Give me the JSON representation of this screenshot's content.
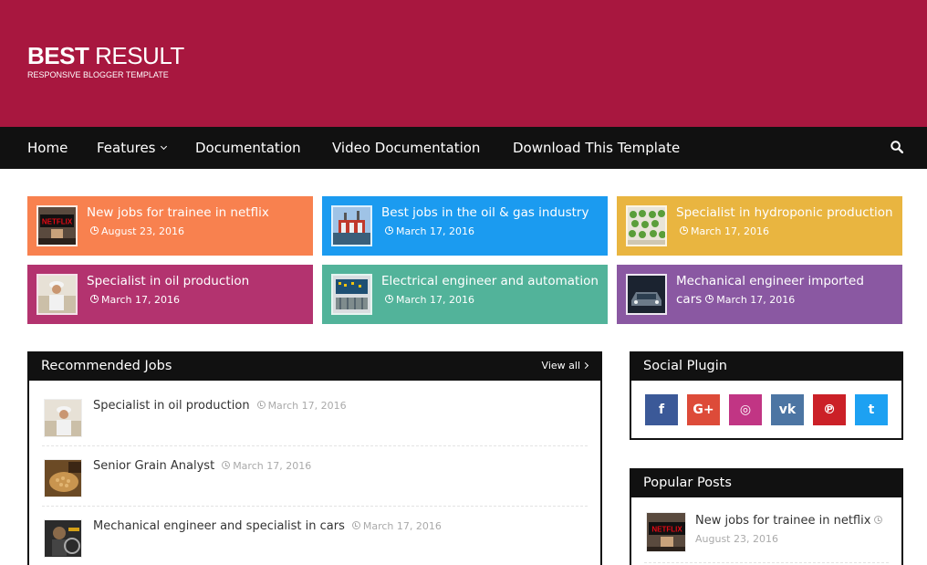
{
  "header": {
    "logo_bold": "BEST",
    "logo_regular": "RESULT",
    "logo_subtitle": "RESPONSIVE BLOGGER TEMPLATE",
    "bg_color": "#a8173f"
  },
  "nav": {
    "items": [
      {
        "label": "Home"
      },
      {
        "label": "Features",
        "dropdown": true
      },
      {
        "label": "Documentation"
      },
      {
        "label": "Video Documentation"
      },
      {
        "label": "Download This Template"
      }
    ],
    "search_icon": "search-icon"
  },
  "featured": [
    {
      "title": "New jobs for trainee in netflix",
      "date": "August 23, 2016",
      "color": "#f8814f",
      "thumb": "netflix"
    },
    {
      "title": "Best jobs in the oil & gas industry",
      "date": "March 17, 2016",
      "color": "#1b9bf0",
      "thumb": "oil-rig"
    },
    {
      "title": "Specialist in hydroponic production",
      "date": "March 17, 2016",
      "color": "#e9b540",
      "thumb": "hydroponic"
    },
    {
      "title": "Specialist in oil production",
      "date": "March 17, 2016",
      "color": "#b3336f",
      "thumb": "worker"
    },
    {
      "title": "Electrical engineer and automation",
      "date": "March 17, 2016",
      "color": "#52b39a",
      "thumb": "electrical"
    },
    {
      "title": "Mechanical engineer imported cars",
      "date": "March 17, 2016",
      "color": "#8a58a2",
      "thumb": "car"
    }
  ],
  "recommended": {
    "title": "Recommended Jobs",
    "view_all": "View all",
    "items": [
      {
        "title": "Specialist in oil production",
        "date": "March 17, 2016",
        "thumb": "worker"
      },
      {
        "title": "Senior Grain Analyst",
        "date": "March 17, 2016",
        "thumb": "grain"
      },
      {
        "title": "Mechanical engineer and specialist in cars",
        "date": "March 17, 2016",
        "thumb": "mechanic"
      }
    ]
  },
  "social": {
    "title": "Social Plugin",
    "buttons": [
      {
        "name": "facebook",
        "glyph": "f",
        "color": "#3b5998"
      },
      {
        "name": "google-plus",
        "glyph": "G+",
        "color": "#dd4b39"
      },
      {
        "name": "instagram",
        "glyph": "◎",
        "color": "#c13584"
      },
      {
        "name": "vk",
        "glyph": "vk",
        "color": "#4c75a3"
      },
      {
        "name": "pinterest",
        "glyph": "℗",
        "color": "#cb2027"
      },
      {
        "name": "twitter",
        "glyph": "t",
        "color": "#1da1f2"
      }
    ]
  },
  "popular": {
    "title": "Popular Posts",
    "items": [
      {
        "title": "New jobs for trainee in netflix",
        "date": "August 23, 2016",
        "thumb": "netflix"
      }
    ]
  }
}
